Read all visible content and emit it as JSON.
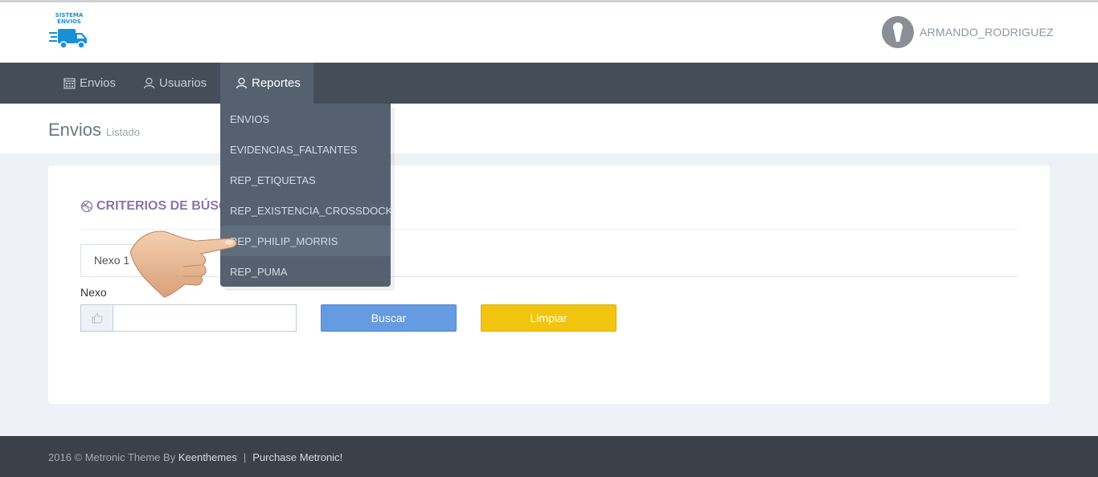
{
  "brand": {
    "logo_line1": "SISTEMA",
    "logo_line2": "ENVIOS"
  },
  "user": {
    "name": "ARMANDO_RODRIGUEZ"
  },
  "nav": {
    "items": [
      {
        "label": "Envios",
        "icon": "calendar-icon"
      },
      {
        "label": "Usuarios",
        "icon": "user-icon"
      },
      {
        "label": "Reportes",
        "icon": "user-icon",
        "active": true
      }
    ]
  },
  "reportes_menu": {
    "items": [
      {
        "label": "ENVIOS"
      },
      {
        "label": "EVIDENCIAS_FALTANTES"
      },
      {
        "label": "REP_ETIQUETAS"
      },
      {
        "label": "REP_EXISTENCIA_CROSSDOCK"
      },
      {
        "label": "REP_PHILIP_MORRIS",
        "hovered": true
      },
      {
        "label": "REP_PUMA"
      }
    ]
  },
  "page": {
    "title": "Envios",
    "subtitle": "Listado"
  },
  "portlet": {
    "caption": "CRITERIOS DE BÚSQUEDA",
    "caption_icon": "dribbble-icon",
    "tabs": [
      {
        "label": "Nexo 1"
      }
    ],
    "field_label": "Nexo",
    "field_icon": "thumbs-up-icon",
    "field_value": "",
    "field_placeholder": "",
    "buscar_label": "Buscar",
    "limpiar_label": "Limpiar"
  },
  "footer": {
    "text": "2016 © Metronic Theme By",
    "author_link": "Keenthemes",
    "separator": "|",
    "purchase_link": "Purchase Metronic!"
  },
  "colors": {
    "navbar": "#444d58",
    "dropdown": "#55616f",
    "caption": "#8877a9",
    "buscar": "#659be0",
    "limpiar": "#f1c40f",
    "footer": "#3a4149"
  }
}
